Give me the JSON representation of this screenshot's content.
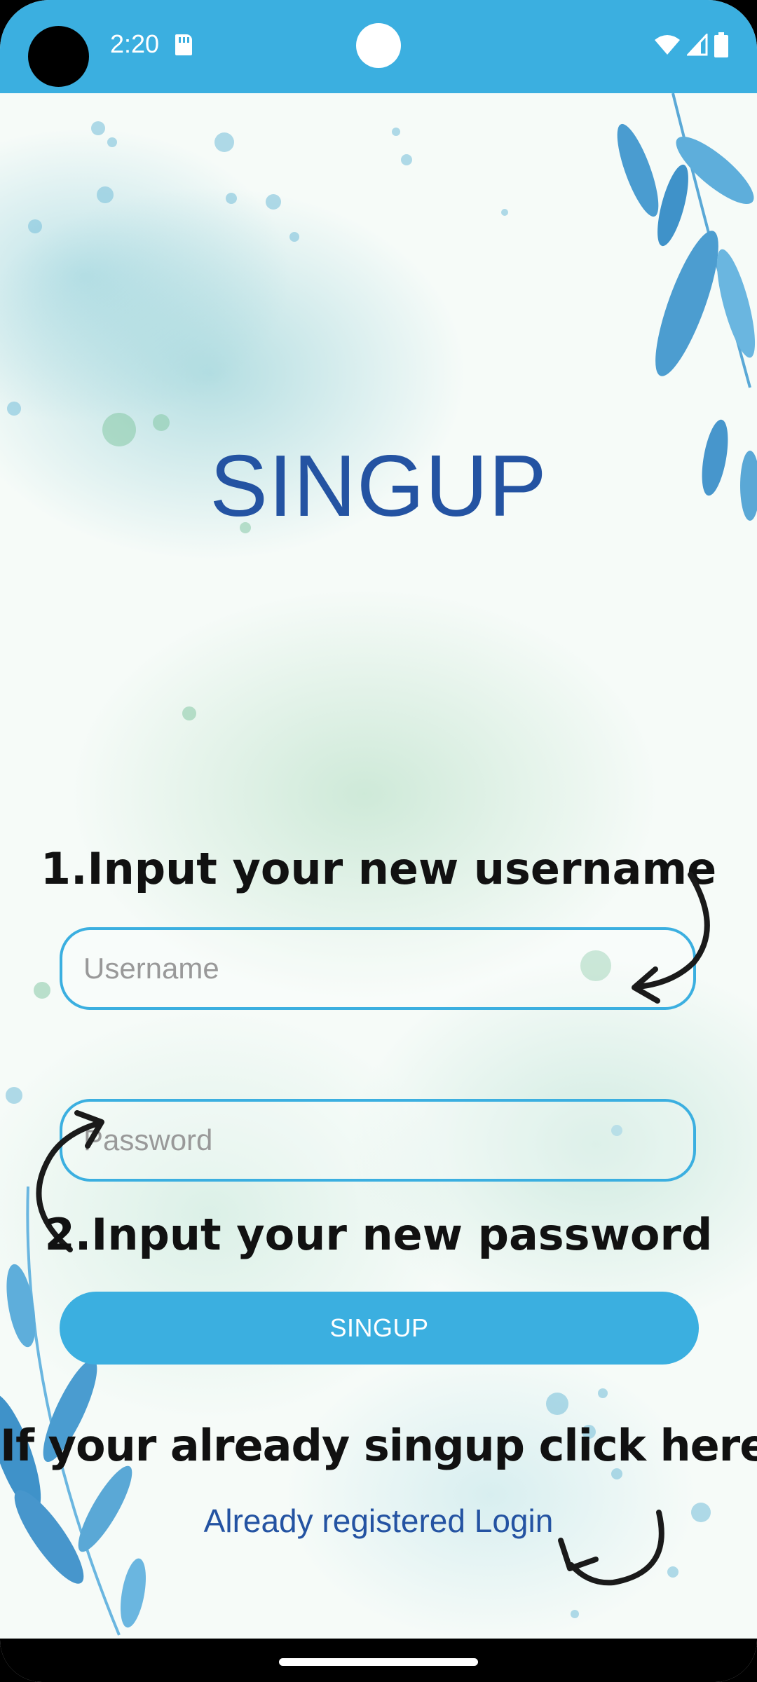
{
  "status_bar": {
    "time": "2:20",
    "icons": [
      "sd-card-icon",
      "wifi-icon",
      "signal-icon",
      "battery-icon"
    ],
    "background": "#3bafe0"
  },
  "screen": {
    "title": "SINGUP",
    "hint_username": "1.Input your new username",
    "username_placeholder": "Username",
    "hint_password": "2.Input your new password",
    "password_placeholder": "Password",
    "signup_button": "SINGUP",
    "hint_login": "If your already singup click here",
    "login_link": "Already registered Login"
  },
  "colors": {
    "accent": "#3bafe0",
    "title": "#2453a2",
    "link": "#2453a2"
  }
}
